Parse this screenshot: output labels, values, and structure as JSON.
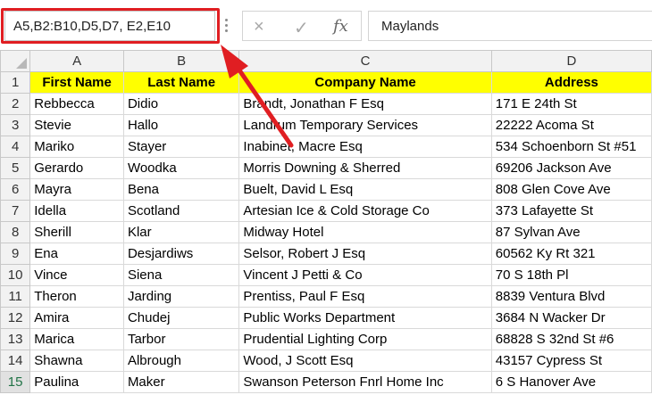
{
  "formula_bar": {
    "name_box": "A5,B2:B10,D5,D7, E2,E10",
    "cancel_icon": "×",
    "enter_icon": "✓",
    "fx_label": "fx",
    "formula_value": "Maylands"
  },
  "columns": [
    "A",
    "B",
    "C",
    "D"
  ],
  "headers": [
    "First Name",
    "Last Name",
    "Company Name",
    "Address"
  ],
  "rows": [
    {
      "num": "2",
      "first": "Rebbecca",
      "last": "Didio",
      "company": "Brandt, Jonathan F Esq",
      "address": "171 E 24th St"
    },
    {
      "num": "3",
      "first": "Stevie",
      "last": "Hallo",
      "company": "Landrum Temporary Services",
      "address": "22222 Acoma St"
    },
    {
      "num": "4",
      "first": "Mariko",
      "last": "Stayer",
      "company": "Inabinet, Macre Esq",
      "address": "534 Schoenborn St #51"
    },
    {
      "num": "5",
      "first": "Gerardo",
      "last": "Woodka",
      "company": "Morris Downing & Sherred",
      "address": "69206 Jackson Ave"
    },
    {
      "num": "6",
      "first": "Mayra",
      "last": "Bena",
      "company": "Buelt, David L Esq",
      "address": "808 Glen Cove Ave"
    },
    {
      "num": "7",
      "first": "Idella",
      "last": "Scotland",
      "company": "Artesian Ice & Cold Storage Co",
      "address": "373 Lafayette St"
    },
    {
      "num": "8",
      "first": "Sherill",
      "last": "Klar",
      "company": "Midway Hotel",
      "address": "87 Sylvan Ave"
    },
    {
      "num": "9",
      "first": "Ena",
      "last": "Desjardiws",
      "company": "Selsor, Robert J Esq",
      "address": "60562 Ky Rt 321"
    },
    {
      "num": "10",
      "first": "Vince",
      "last": "Siena",
      "company": "Vincent J Petti & Co",
      "address": "70 S 18th Pl"
    },
    {
      "num": "11",
      "first": "Theron",
      "last": "Jarding",
      "company": "Prentiss, Paul F Esq",
      "address": "8839 Ventura Blvd"
    },
    {
      "num": "12",
      "first": "Amira",
      "last": "Chudej",
      "company": "Public Works Department",
      "address": "3684 N Wacker Dr"
    },
    {
      "num": "13",
      "first": "Marica",
      "last": "Tarbor",
      "company": "Prudential Lighting Corp",
      "address": "68828 S 32nd St #6"
    },
    {
      "num": "14",
      "first": "Shawna",
      "last": "Albrough",
      "company": "Wood, J Scott Esq",
      "address": "43157 Cypress St"
    },
    {
      "num": "15",
      "first": "Paulina",
      "last": "Maker",
      "company": "Swanson Peterson Fnrl Home Inc",
      "address": "6 S Hanover Ave"
    }
  ],
  "header_row_num": "1",
  "colors": {
    "highlight": "#e01e22",
    "header_fill": "#ffff00",
    "selected_row_text": "#217346"
  }
}
